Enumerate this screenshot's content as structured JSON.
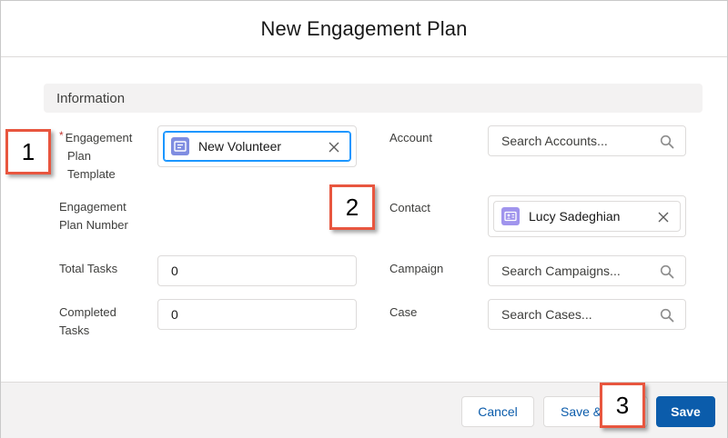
{
  "modal": {
    "title": "New Engagement Plan"
  },
  "section": {
    "title": "Information"
  },
  "fields": {
    "template": {
      "required_mark": "*",
      "label_line1": "Engagement",
      "label_line2": "Plan",
      "label_line3": "Template",
      "value": "New Volunteer"
    },
    "plan_number": {
      "label_line1": "Engagement",
      "label_line2": "Plan Number"
    },
    "total_tasks": {
      "label": "Total Tasks",
      "value": "0"
    },
    "completed_tasks": {
      "label_line1": "Completed",
      "label_line2": "Tasks",
      "value": "0"
    },
    "account": {
      "label": "Account",
      "placeholder": "Search Accounts..."
    },
    "contact": {
      "label": "Contact",
      "value": "Lucy Sadeghian"
    },
    "campaign": {
      "label": "Campaign",
      "placeholder": "Search Campaigns..."
    },
    "case": {
      "label": "Case",
      "placeholder": "Search Cases..."
    }
  },
  "footer": {
    "cancel_label": "Cancel",
    "save_new_label": "Save &",
    "save_label": "Save"
  },
  "callouts": [
    "1",
    "2",
    "3"
  ],
  "colors": {
    "brand": "#0b5cab",
    "focus": "#1b96ff",
    "callout_border": "#e8563f",
    "template_icon": "#7f8de1",
    "contact_icon": "#a094ed"
  },
  "icons": {
    "template": "task-template-icon",
    "contact": "contact-card-icon",
    "search": "search-icon",
    "clear": "close-icon"
  }
}
